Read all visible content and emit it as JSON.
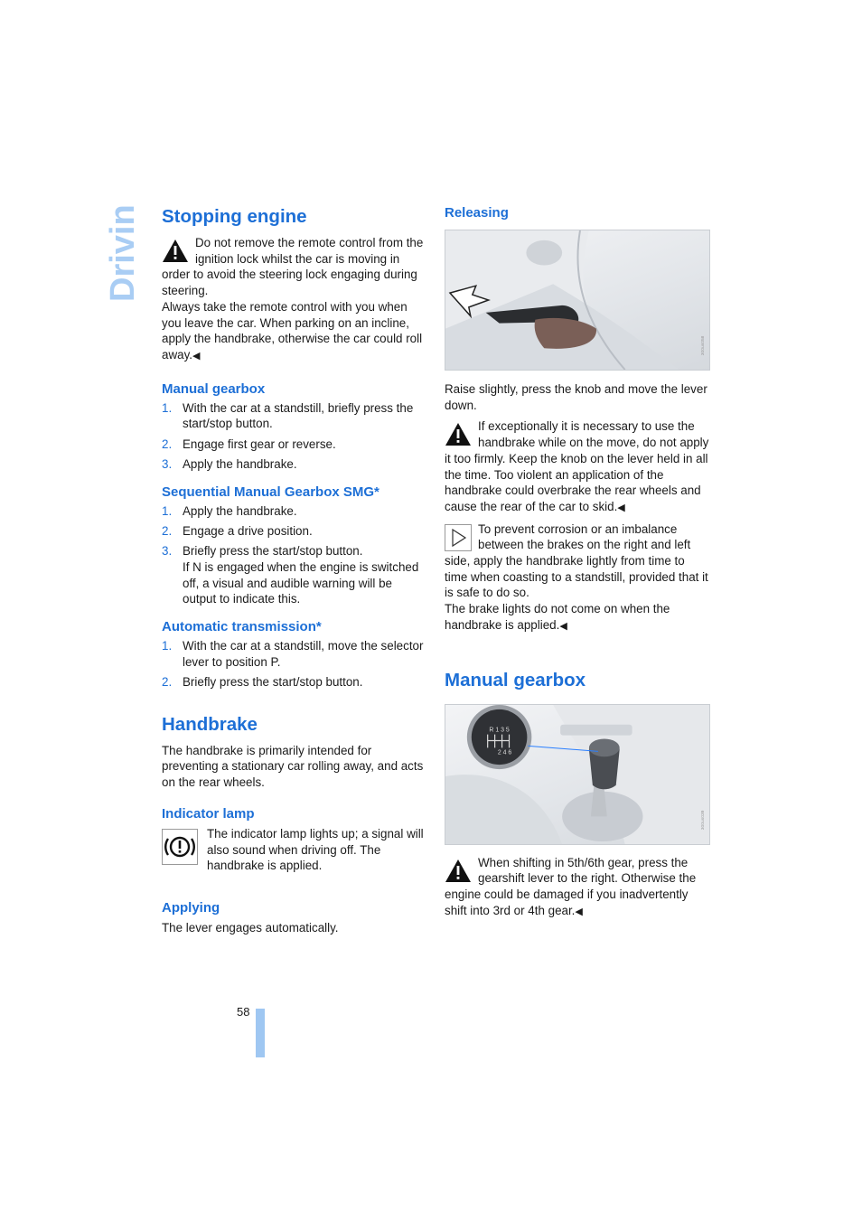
{
  "side_tab": {
    "label": "Driving",
    "color": "#a9cdf4"
  },
  "left": {
    "stopping_engine": {
      "title": "Stopping engine",
      "warning": "Do not remove the remote control from the ignition lock whilst the car is moving in order to avoid the steering lock engaging during steering.",
      "warning_cont": "Always take the remote control with you when you leave the car. When parking on an incline, apply the handbrake, otherwise the car could roll away.",
      "end_mark": "◀"
    },
    "manual_gearbox": {
      "title": "Manual gearbox",
      "steps": [
        {
          "num": "1.",
          "text": "With the car at a standstill, briefly press the start/stop button."
        },
        {
          "num": "2.",
          "text": "Engage first gear or reverse."
        },
        {
          "num": "3.",
          "text": "Apply the handbrake."
        }
      ]
    },
    "smg": {
      "title": "Sequential Manual Gearbox SMG*",
      "steps": [
        {
          "num": "1.",
          "text": "Apply the handbrake."
        },
        {
          "num": "2.",
          "text": "Engage a drive position."
        },
        {
          "num": "3.",
          "text": "Briefly press the start/stop button.",
          "extra": "If N is engaged when the engine is switched off, a visual and audible warning will be output to indicate this."
        }
      ]
    },
    "automatic": {
      "title": "Automatic transmission*",
      "steps": [
        {
          "num": "1.",
          "text": "With the car at a standstill, move the selector lever to position P."
        },
        {
          "num": "2.",
          "text": "Briefly press the start/stop button."
        }
      ]
    },
    "handbrake": {
      "title": "Handbrake",
      "intro": "The handbrake is primarily intended for preventing a stationary car rolling away, and acts on the rear wheels."
    },
    "indicator_lamp": {
      "title": "Indicator lamp",
      "text": "The indicator lamp lights up; a signal will also sound when driving off. The handbrake is applied."
    },
    "applying": {
      "title": "Applying",
      "text": "The lever engages automatically."
    }
  },
  "right": {
    "releasing": {
      "title": "Releasing",
      "caption": "Raise slightly, press the knob and move the lever down.",
      "warning": "If exceptionally it is necessary to use the handbrake while on the move, do not apply it too firmly. Keep the knob on the lever held in all the time. Too violent an application of the handbrake could overbrake the rear wheels and cause the rear of the car to skid.",
      "note": "To prevent corrosion or an imbalance between the brakes on the right and left side, apply the handbrake lightly from time to time when coasting to a standstill, provided that it is safe to do so.",
      "note_cont": "The brake lights do not come on when the handbrake is applied.",
      "end_mark": "◀"
    },
    "manual_gearbox": {
      "title": "Manual gearbox",
      "shift_pattern_top": "R 1 3 5",
      "shift_pattern_bottom": "2 4 6",
      "warning": "When shifting in 5th/6th gear, press the gearshift lever to the right. Otherwise the engine could be damaged if you inadvertently shift into 3rd or 4th gear.",
      "end_mark": "◀"
    }
  },
  "footer": {
    "page_number": "58"
  }
}
